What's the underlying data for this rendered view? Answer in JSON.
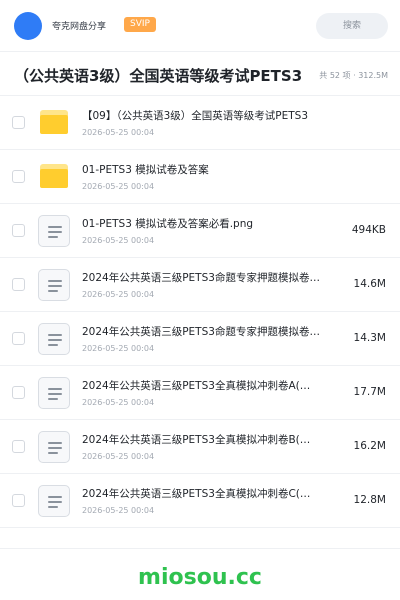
{
  "header": {
    "brand": "夸克网盘分享",
    "badge": "SVIP",
    "search_label": "搜索"
  },
  "title_bar": {
    "title": "（公共英语3级）全国英语等级考试PETS3",
    "meta": "共 52 项 · 312.5M"
  },
  "files": [
    {
      "type": "folder",
      "icon": "folder-icon",
      "name": "【09】（公共英语3级）全国英语等级考试PETS3",
      "date": "2026-05-25 00:04",
      "size": ""
    },
    {
      "type": "folder",
      "icon": "folder-icon",
      "name": "01-PETS3 模拟试卷及答案",
      "date": "2026-05-25 00:04",
      "size": ""
    },
    {
      "type": "file",
      "icon": "document-icon",
      "name": "01-PETS3 模拟试卷及答案必看.png",
      "date": "2026-05-25 00:04",
      "size": "494KB"
    },
    {
      "type": "file",
      "icon": "document-icon",
      "name": "2024年公共英语三级PETS3命题专家押题模拟卷…",
      "date": "2026-05-25 00:04",
      "size": "14.6M"
    },
    {
      "type": "file",
      "icon": "document-icon",
      "name": "2024年公共英语三级PETS3命题专家押题模拟卷…",
      "date": "2026-05-25 00:04",
      "size": "14.3M"
    },
    {
      "type": "file",
      "icon": "document-icon",
      "name": "2024年公共英语三级PETS3全真模拟冲刺卷A(…",
      "date": "2026-05-25 00:04",
      "size": "17.7M"
    },
    {
      "type": "file",
      "icon": "document-icon",
      "name": "2024年公共英语三级PETS3全真模拟冲刺卷B(…",
      "date": "2026-05-25 00:04",
      "size": "16.2M"
    },
    {
      "type": "file",
      "icon": "document-icon",
      "name": "2024年公共英语三级PETS3全真模拟冲刺卷C(…",
      "date": "2026-05-25 00:04",
      "size": "12.8M"
    }
  ],
  "watermark": "miosou.cc",
  "colors": {
    "avatar": "#2f7cf6",
    "badge": "#ffa84a",
    "folder": "#ffcd2e",
    "watermark": "#2fc24f"
  }
}
